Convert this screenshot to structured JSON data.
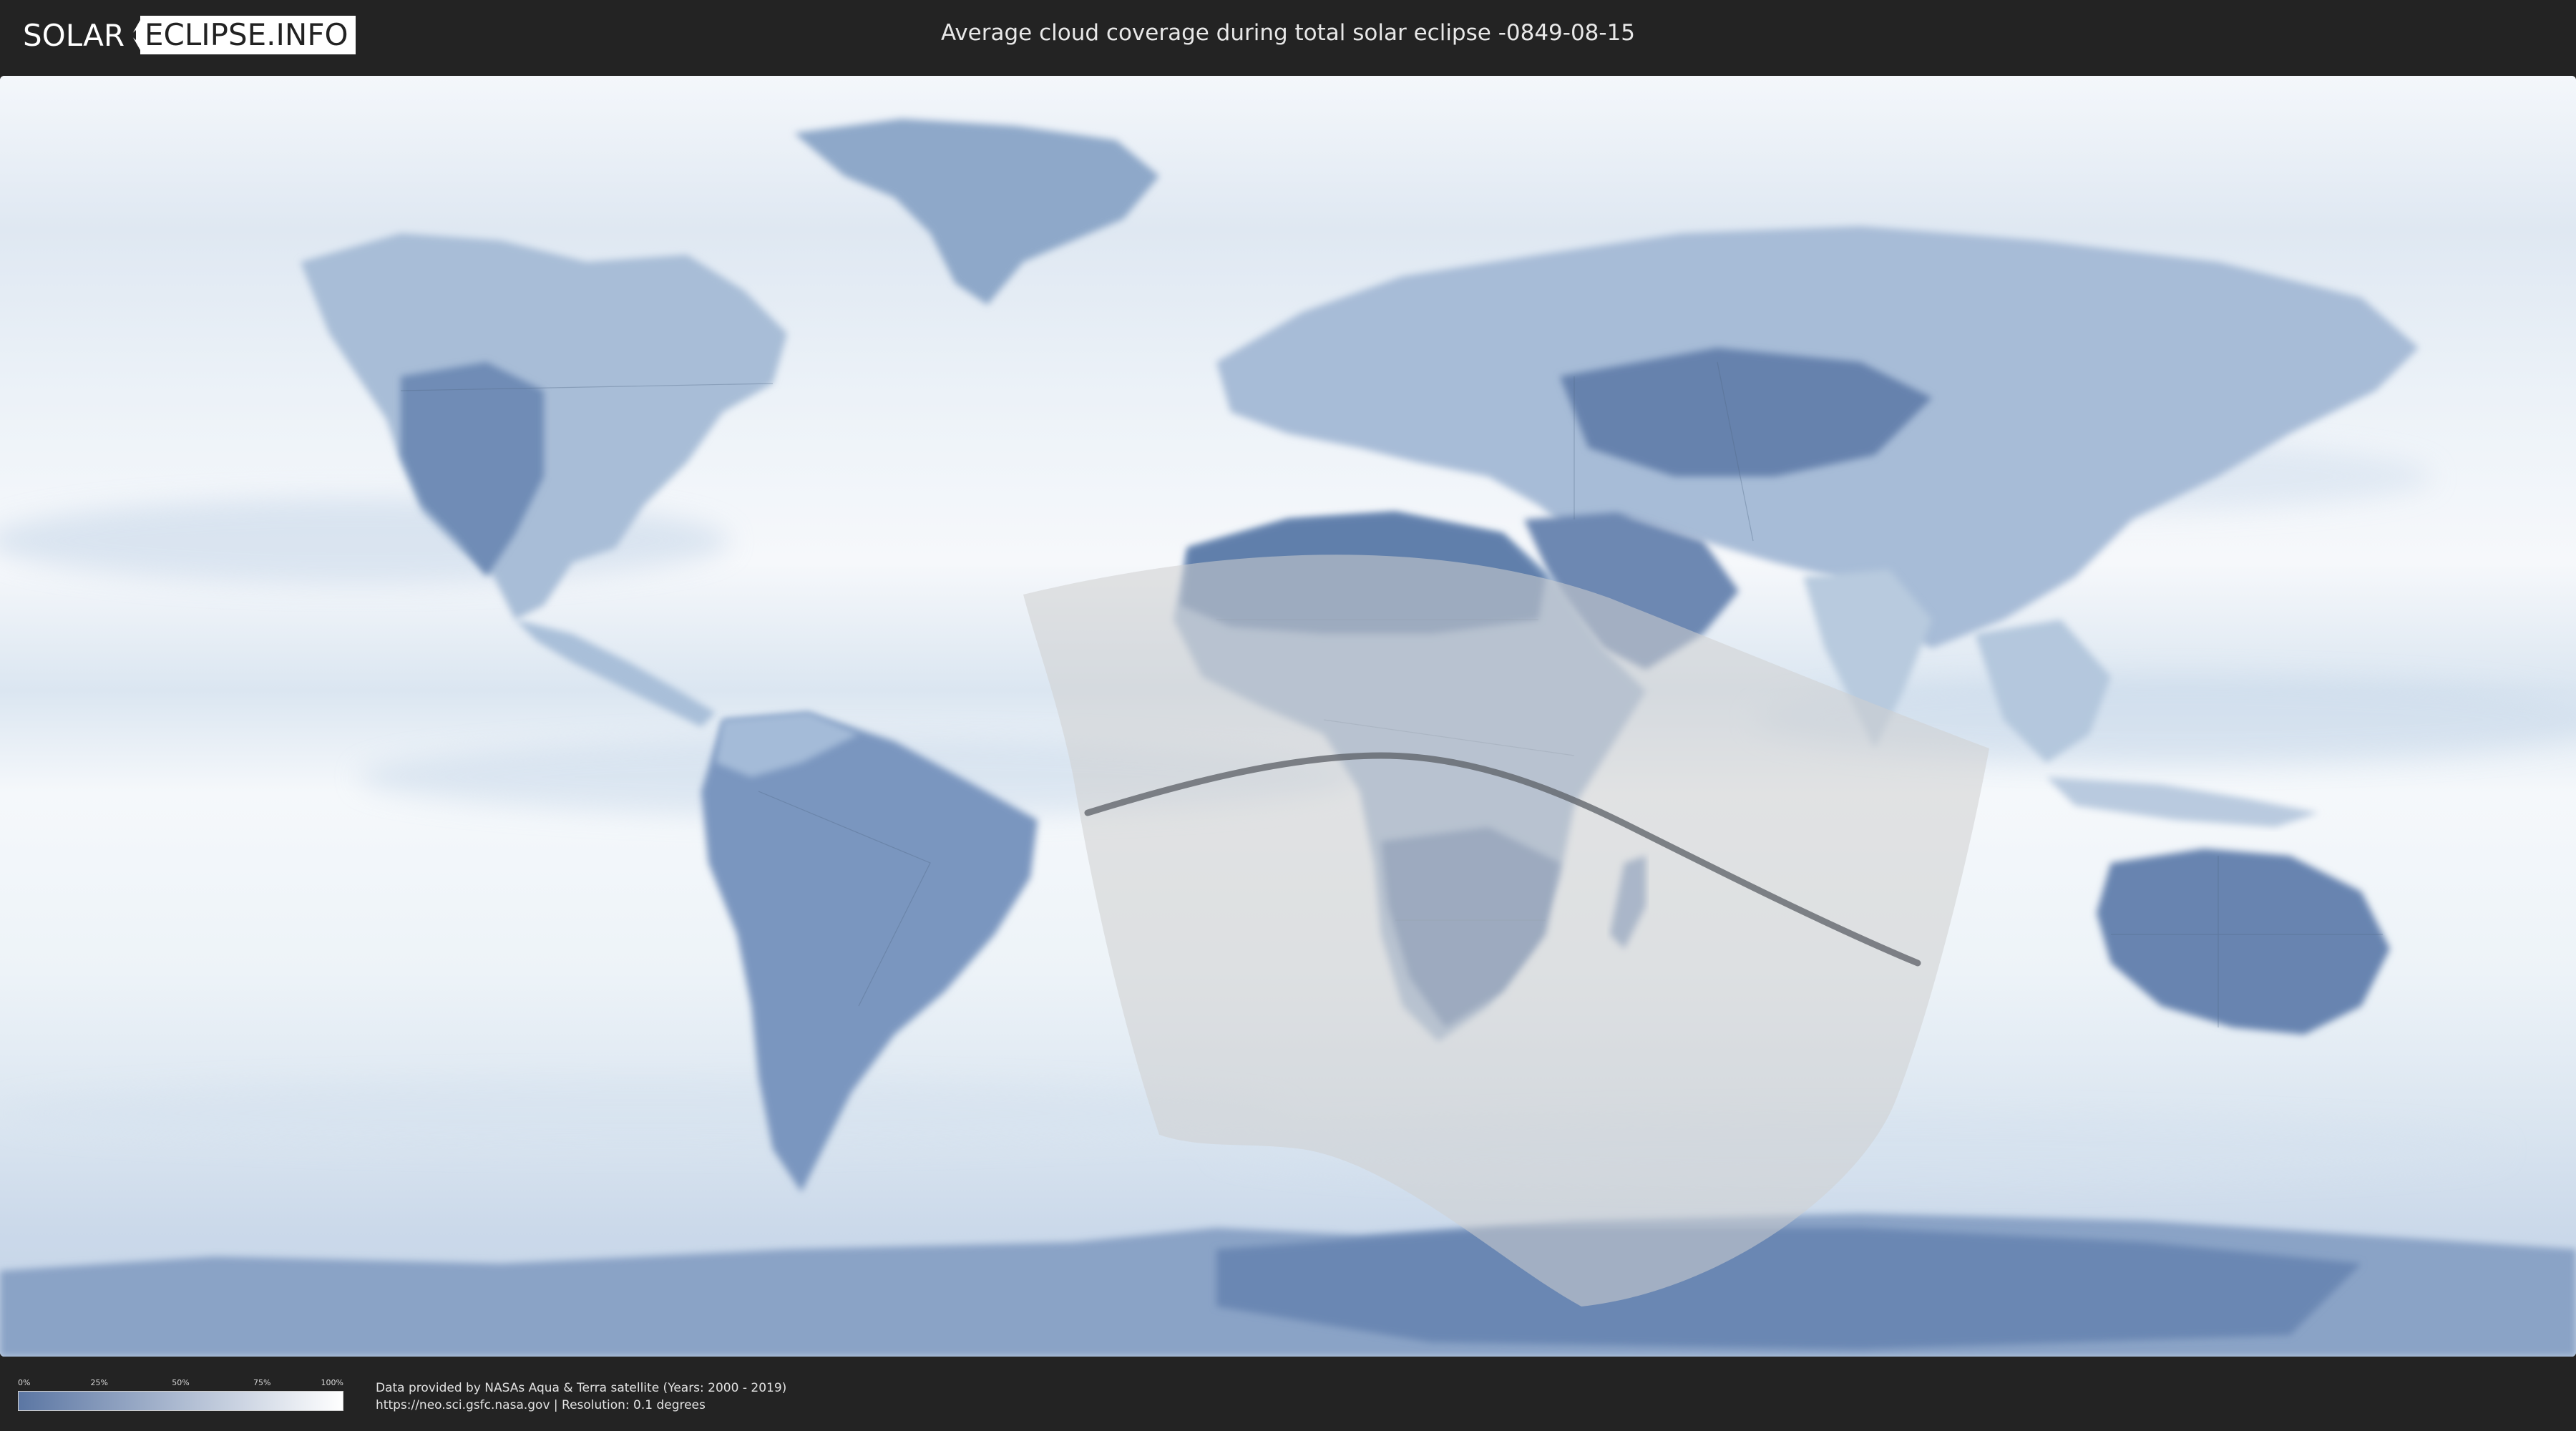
{
  "header": {
    "logo_left": "SOLAR",
    "logo_right": "ECLIPSE.INFO",
    "title": "Average cloud coverage during total solar eclipse -0849-08-15"
  },
  "map": {
    "colors": {
      "ocean_clear": "#f7f9fc",
      "cloud_band": "#d3e1ef",
      "land_clear": "#5f7fae",
      "land_mid": "#8ca6c8",
      "ice": "#7d97c0",
      "eclipse_overlay": "#c9c9c9",
      "central_line": "#5b5f66",
      "border_lines": "#506785"
    }
  },
  "legend": {
    "ticks": [
      "0%",
      "25%",
      "50%",
      "75%",
      "100%"
    ],
    "gradient_start": "#5b76a3",
    "gradient_end": "#ffffff"
  },
  "credits": {
    "line1": "Data provided by NASAs Aqua & Terra satellite (Years: 2000 - 2019)",
    "line2": "https://neo.sci.gsfc.nasa.gov | Resolution: 0.1 degrees"
  }
}
